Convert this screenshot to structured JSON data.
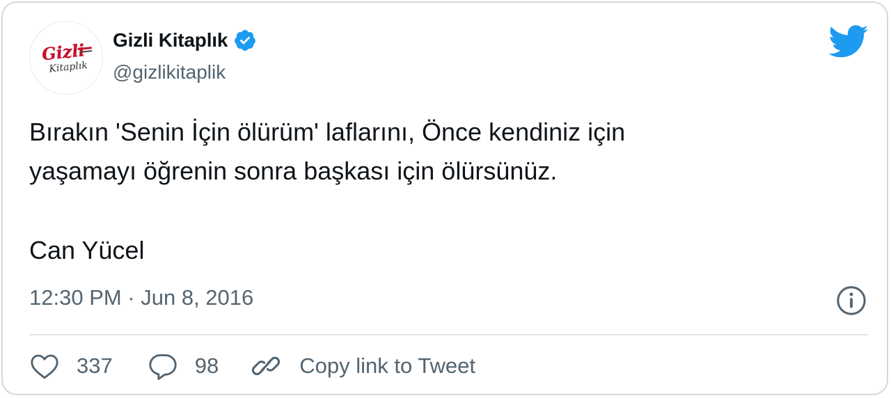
{
  "account": {
    "display_name": "Gizli Kitaplık",
    "handle": "@gizlikitaplik",
    "verified": true,
    "avatar_text": [
      "Gizli",
      "Kitaplık"
    ],
    "avatar_color": "#c8102e"
  },
  "tweet": {
    "lines": [
      "Bırakın 'Senin İçin ölürüm' laflarını, Önce kendiniz için",
      "yaşamayı öğrenin sonra başkası için ölürsünüz.",
      "Can Yücel"
    ],
    "timestamp": "12:30 PM · Jun 8, 2016"
  },
  "actions": {
    "likes": "337",
    "replies": "98",
    "copy_link_label": "Copy link to Tweet"
  },
  "icons": {
    "brand": "twitter-bird-icon",
    "verified": "verified-badge-icon",
    "info": "info-icon",
    "like": "heart-icon",
    "reply": "speech-bubble-icon",
    "copy": "link-icon"
  },
  "colors": {
    "twitter_blue": "#1d9bf0",
    "text_primary": "#0f1419",
    "text_secondary": "#536471",
    "border": "#cfd9de"
  }
}
